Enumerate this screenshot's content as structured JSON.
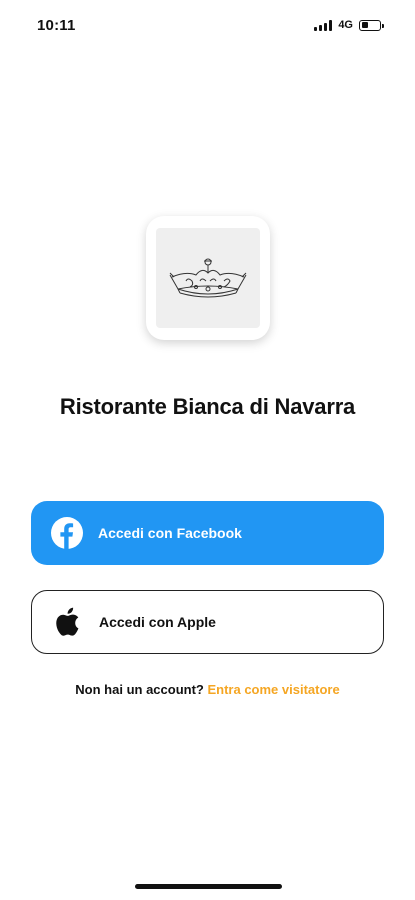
{
  "status_bar": {
    "time": "10:11",
    "network": "4G",
    "battery_level": 0.35
  },
  "logo": {
    "icon": "crown-icon"
  },
  "restaurant_name": "Ristorante Bianca di Navarra",
  "buttons": {
    "facebook": {
      "label": "Accedi con Facebook",
      "icon": "facebook-icon",
      "color": "#2196f3"
    },
    "apple": {
      "label": "Accedi con Apple",
      "icon": "apple-icon"
    }
  },
  "signup": {
    "prompt": "Non hai un account?",
    "guest_link": "Entra come visitatore",
    "link_color": "#f5a623"
  }
}
